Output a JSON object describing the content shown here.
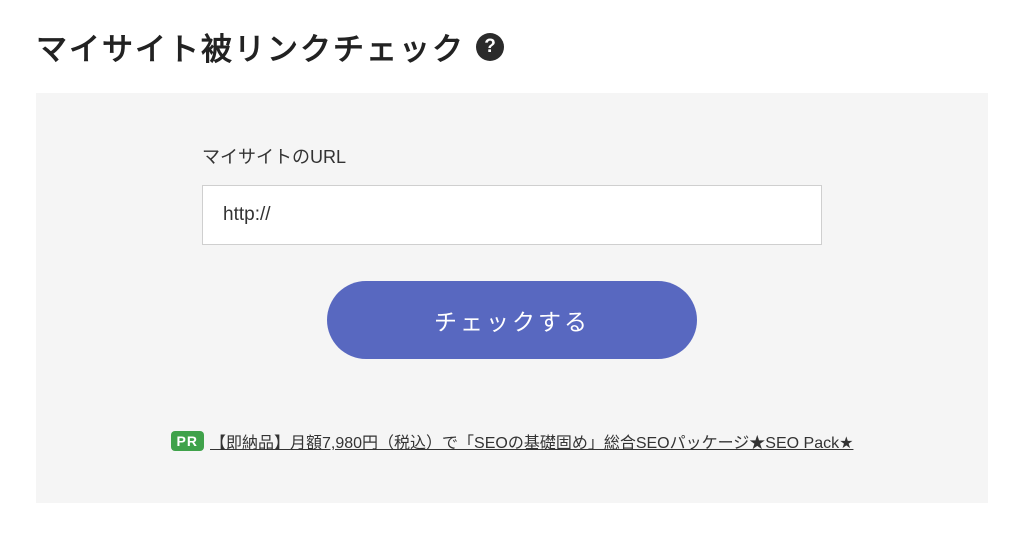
{
  "title": "マイサイト被リンクチェック",
  "form": {
    "label": "マイサイトのURL",
    "url_value": "http://",
    "submit_label": "チェックする"
  },
  "pr": {
    "badge": "PR",
    "text": "【即納品】月額7,980円（税込）で「SEOの基礎固め」総合SEOパッケージ★SEO Pack★"
  }
}
